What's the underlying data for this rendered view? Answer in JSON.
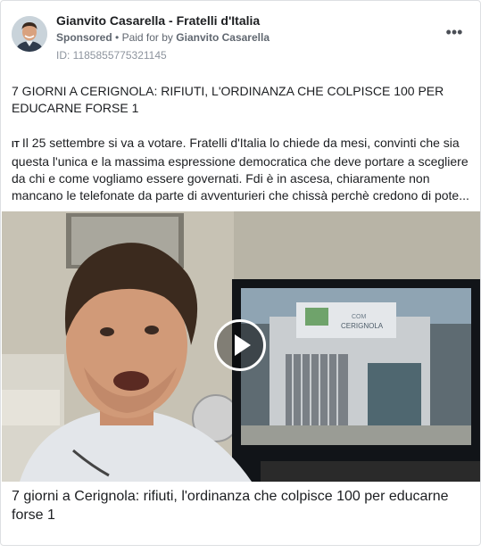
{
  "post": {
    "advertiser_name": "Gianvito Casarella - Fratelli d'Italia",
    "sponsored_label": "Sponsored",
    "separator": "•",
    "paid_for_label": "Paid for by",
    "paid_for_name": "Gianvito Casarella",
    "ad_id": "ID: 1185855775321145",
    "more_options_label": "•••",
    "headline": "7 GIORNI A CERIGNOLA: RIFIUTI, L'ORDINANZA CHE COLPISCE 100 PER EDUCARNE FORSE 1",
    "flag_emoji_text": "IT",
    "body": "Il 25 settembre si va a votare. Fratelli d'Italia lo chiede da mesi, convinti che sia questa l'unica e la massima espressione democratica che deve portare a scegliere da chi e come vogliamo essere governati. Fdi è in ascesa, chiaramente non mancano le telefonate da parte di avventurieri che chissà perchè credono di pote...",
    "video": {
      "sign_text_top": "COM",
      "sign_text_main": "CERIGNOLA"
    },
    "link_title": "7 giorni a Cerignola: rifiuti, l'ordinanza che colpisce 100 per educarne forse 1"
  },
  "icons": {
    "avatar": "avatar-photo",
    "more": "more-options-icon",
    "play": "play-icon"
  },
  "colors": {
    "text_primary": "#1c1e21",
    "text_secondary": "#606770",
    "text_muted": "#8d949e",
    "border": "#dddfe2"
  }
}
